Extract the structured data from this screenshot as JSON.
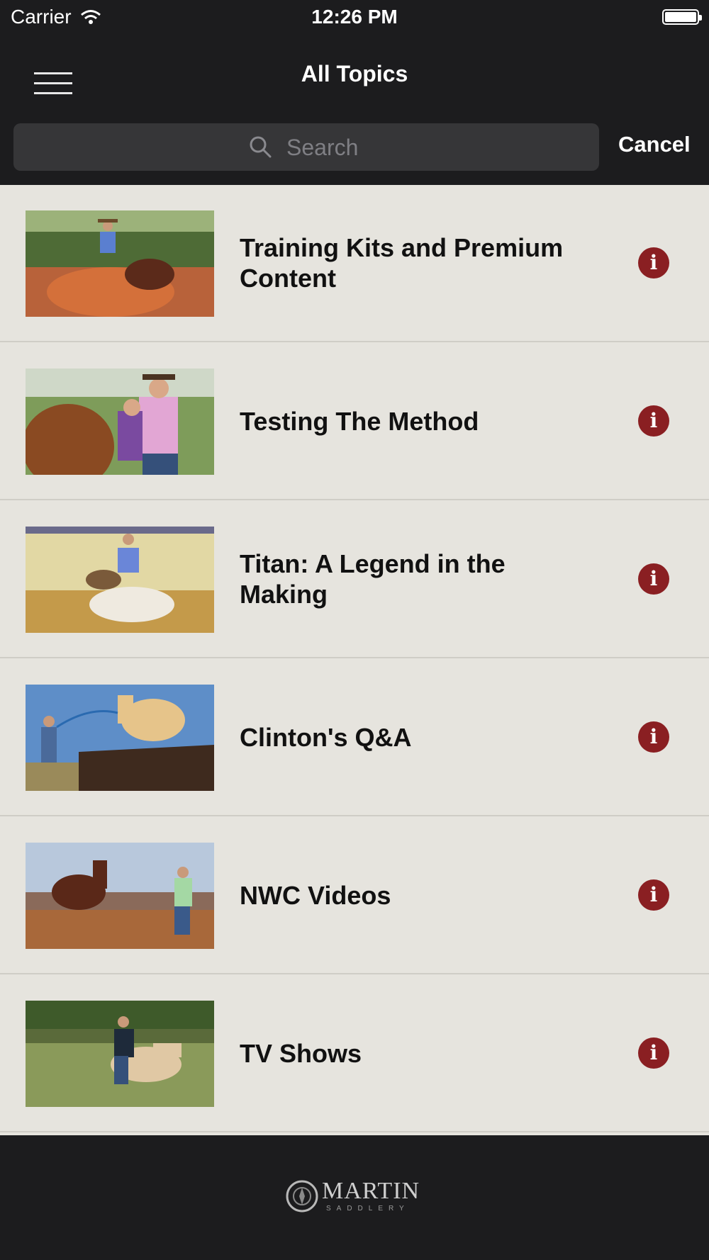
{
  "status_bar": {
    "carrier": "Carrier",
    "time": "12:26 PM"
  },
  "nav": {
    "title": "All Topics"
  },
  "search": {
    "placeholder": "Search",
    "cancel_label": "Cancel"
  },
  "topics": [
    {
      "title": "Training Kits and Premium Content"
    },
    {
      "title": "Testing The Method"
    },
    {
      "title": "Titan: A Legend in the Making"
    },
    {
      "title": "Clinton's Q&A"
    },
    {
      "title": "NWC Videos"
    },
    {
      "title": "TV Shows"
    }
  ],
  "footer": {
    "logo_text": "MARTIN",
    "logo_subtext": "SADDLERY"
  },
  "colors": {
    "accent": "#8a1f22",
    "background": "#1c1c1e",
    "list_background": "#e6e4de"
  }
}
